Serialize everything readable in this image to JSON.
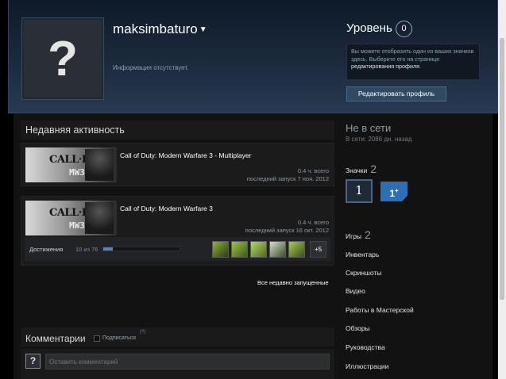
{
  "profile": {
    "username": "maksimbaturo",
    "no_info": "Информация отсутствует.",
    "avatar_glyph": "?"
  },
  "level": {
    "label": "Уровень",
    "value": "0",
    "note_text": "Вы можете отобразить один из ваших значков здесь. Выберите его на странице ",
    "note_link": "редактирования профиля",
    "note_end": "."
  },
  "edit_button": "Редактировать профиль",
  "activity": {
    "title": "Недавняя активность",
    "games": [
      {
        "title": "Call of Duty: Modern Warfare 3 - Multiplayer",
        "hours": "0.4 ч. всего",
        "last_played": "последний запуск 7 ноя. 2012",
        "logo_top": "CALL·DUTY",
        "logo_bottom": "MW3"
      },
      {
        "title": "Call of Duty: Modern Warfare 3",
        "hours": "0.4 ч. всего",
        "last_played": "последний запуск 16 окт. 2012",
        "logo_top": "CALL·DUTY",
        "logo_bottom": "MW3",
        "achievements": {
          "label": "Достижения",
          "count": "10 из 76",
          "progress": 0.13,
          "more": "+5",
          "icons": [
            "achievement-rifle-icon",
            "achievement-map-icon",
            "achievement-weapon-icon",
            "achievement-piano-icon",
            "achievement-gear-icon"
          ]
        }
      }
    ],
    "recent_link": "Все недавно запущенные"
  },
  "comments": {
    "title": "Комментарии",
    "subscribe": "Подписаться",
    "help": "(?)",
    "placeholder": "Оставить комментарий",
    "avatar_glyph": "?"
  },
  "sidebar": {
    "status": "Не в сети",
    "last_online": "В сети: 2086 дн. назад",
    "badges_label": "Значки",
    "badges_count": "2",
    "badge1": "1",
    "badge2": "1",
    "badge2_sup": "+",
    "games_label": "Игры",
    "games_count": "2",
    "links": [
      "Инвентарь",
      "Скриншоты",
      "Видео",
      "Работы в Мастерской",
      "Обзоры",
      "Руководства",
      "Иллюстрации"
    ]
  }
}
